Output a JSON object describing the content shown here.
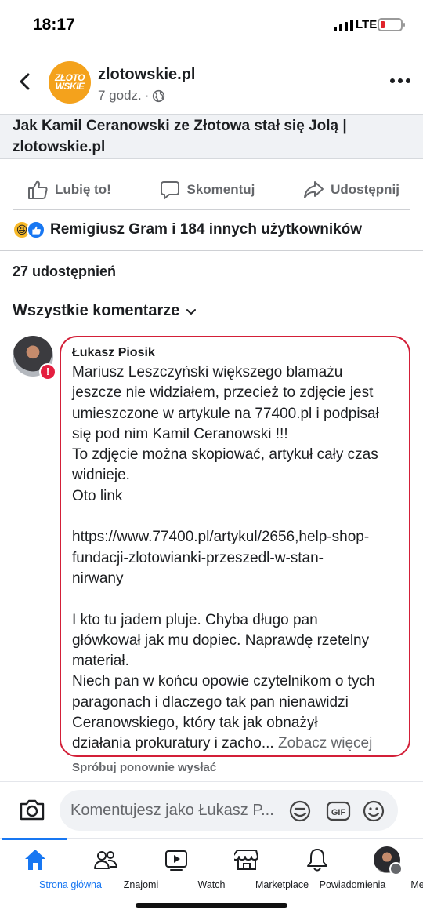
{
  "status_bar": {
    "time": "18:17",
    "network": "LTE",
    "battery_color": "#e0242b"
  },
  "post": {
    "page_name": "zlotowskie.pl",
    "time": "7 godz.",
    "logo_text": [
      "ZŁOTO",
      "WSKIE"
    ],
    "link_title_line1": "Jak Kamil Ceranowski ze Złotowa stał się Jolą |",
    "link_title_line2": "zlotowskie.pl"
  },
  "actions": {
    "like": "Lubię to!",
    "comment": "Skomentuj",
    "share": "Udostępnij"
  },
  "reactions": {
    "text": "Remigiusz Gram i 184 innych użytkowników"
  },
  "shares": "27 udostępnień",
  "comments_filter": "Wszystkie komentarze",
  "comment": {
    "author": "Łukasz Piosik",
    "lines": [
      "Mariusz Leszczyński większego blamażu",
      "jeszcze nie widziałem, przecież to zdjęcie jest",
      "umieszczone w artykule na 77400.pl i podpisał",
      "się pod nim Kamil Ceranowski !!!",
      "To zdjęcie można skopiować, artykuł cały czas",
      "widnieje.",
      "Oto link",
      "",
      "https://www.77400.pl/artykul/2656,help-shop-",
      "fundacji-zlotowianki-przeszedl-w-stan-",
      "nirwany",
      "",
      "I kto tu jadem pluje. Chyba długo pan",
      "główkował jak mu dopiec. Naprawdę rzetelny",
      "materiał.",
      "Niech pan w końcu opowie czytelnikom o tych",
      "paragonach i dlaczego tak pan nienawidzi",
      "Ceranowskiego, który tak jak obnażył"
    ],
    "last_line": "działania prokuratury i zacho...",
    "see_more": " Zobacz więcej",
    "retry": "Spróbuj ponownie wysłać",
    "error_color": "#d31f38"
  },
  "composer": {
    "placeholder": "Komentujesz jako Łukasz P..."
  },
  "tabs": [
    {
      "label": "Strona główna",
      "icon": "home-icon"
    },
    {
      "label": "Znajomi",
      "icon": "friends-icon"
    },
    {
      "label": "Watch",
      "icon": "watch-icon"
    },
    {
      "label": "Marketplace",
      "icon": "marketplace-icon"
    },
    {
      "label": "Powiadomienia",
      "icon": "bell-icon"
    },
    {
      "label": "Menu",
      "icon": "profile-avatar"
    }
  ],
  "accent_color": "#1877f2"
}
